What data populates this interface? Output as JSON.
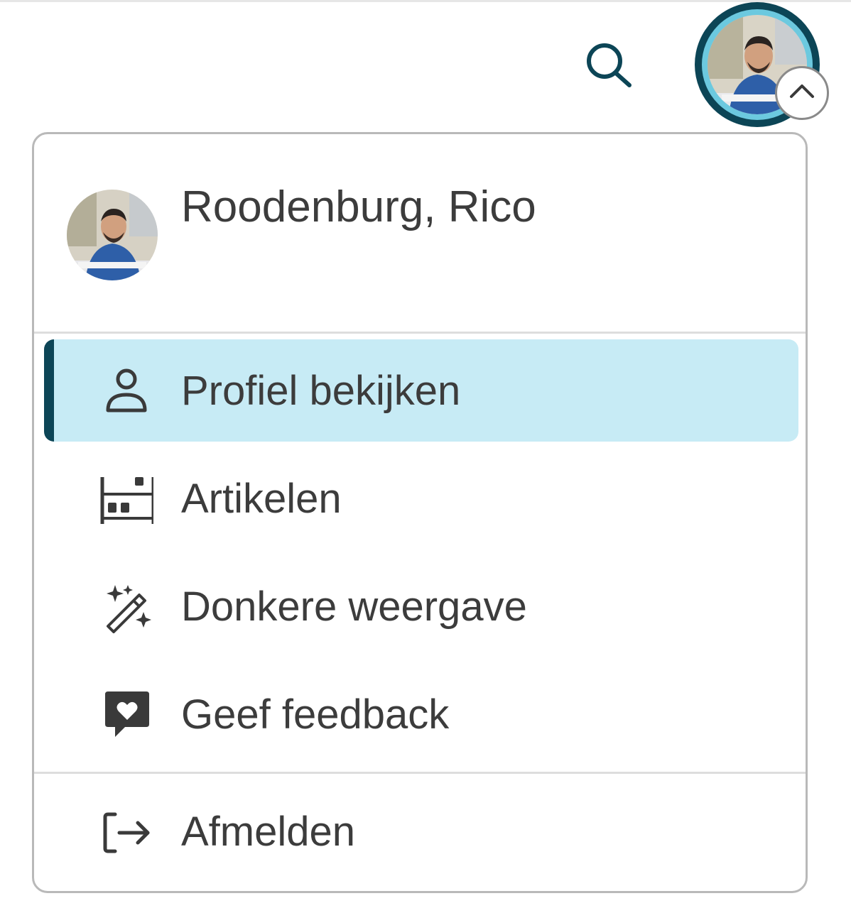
{
  "header": {
    "search_icon": "search-icon",
    "account_button_icon": "chevron-up-icon"
  },
  "user": {
    "name": "Roodenburg, Rico"
  },
  "menu": {
    "items": [
      {
        "label": "Profiel bekijken",
        "icon": "person-icon",
        "active": true
      },
      {
        "label": "Artikelen",
        "icon": "articles-icon",
        "active": false
      },
      {
        "label": "Donkere weergave",
        "icon": "magic-wand-icon",
        "active": false
      },
      {
        "label": "Geef feedback",
        "icon": "feedback-heart-icon",
        "active": false
      }
    ],
    "signout": {
      "label": "Afmelden",
      "icon": "sign-out-icon"
    }
  },
  "colors": {
    "accent_dark": "#0c4556",
    "accent_light": "#6cc9df",
    "active_bg": "#c7ebf5",
    "text": "#3c3c3c",
    "border": "#b9b9b9"
  }
}
